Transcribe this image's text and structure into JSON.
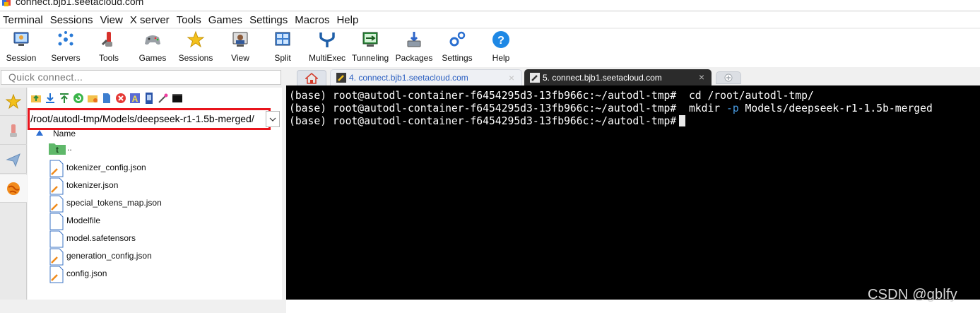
{
  "window": {
    "title": "connect.bjb1.seetacloud.com"
  },
  "menu": [
    "Terminal",
    "Sessions",
    "View",
    "X server",
    "Tools",
    "Games",
    "Settings",
    "Macros",
    "Help"
  ],
  "toolbar": [
    {
      "label": "Session",
      "icon": "session-icon"
    },
    {
      "label": "Servers",
      "icon": "servers-icon"
    },
    {
      "label": "Tools",
      "icon": "tools-icon"
    },
    {
      "label": "Games",
      "icon": "games-icon"
    },
    {
      "label": "Sessions",
      "icon": "sessions-star-icon"
    },
    {
      "label": "View",
      "icon": "view-icon"
    },
    {
      "label": "Split",
      "icon": "split-icon"
    },
    {
      "label": "MultiExec",
      "icon": "multiexec-icon"
    },
    {
      "label": "Tunneling",
      "icon": "tunneling-icon"
    },
    {
      "label": "Packages",
      "icon": "packages-icon"
    },
    {
      "label": "Settings",
      "icon": "settings-icon"
    },
    {
      "label": "Help",
      "icon": "help-icon"
    }
  ],
  "quick_connect": {
    "placeholder": "Quick connect..."
  },
  "sftp": {
    "path": "/root/autodl-tmp/Models/deepseek-r1-1.5b-merged/",
    "column_name": "Name",
    "parent_label": "..",
    "files": [
      "tokenizer_config.json",
      "tokenizer.json",
      "special_tokens_map.json",
      "Modelfile",
      "model.safetensors",
      "generation_config.json",
      "config.json"
    ]
  },
  "tabs": {
    "inactive": {
      "label": "4. connect.bjb1.seetacloud.com"
    },
    "active": {
      "label": "5. connect.bjb1.seetacloud.com"
    },
    "close_glyph": "×"
  },
  "terminal": {
    "prompt": "(base) root@autodl-container-f6454295d3-13fb966c:~/autodl-tmp#",
    "lines": [
      {
        "cmd_before": "cd /root/autodl-tmp/",
        "flag": "",
        "cmd_after": ""
      },
      {
        "cmd_before": "mkdir ",
        "flag": "-p",
        "cmd_after": " Models/deepseek-r1-1.5b-merged"
      },
      {
        "cmd_before": "",
        "flag": "",
        "cmd_after": ""
      }
    ]
  },
  "watermark": "CSDN @gblfy",
  "colors": {
    "highlight_box": "#e8141c",
    "terminal_bg": "#000000",
    "flag": "#4a9ee6",
    "inactive_tab_text": "#2b5fc1"
  }
}
